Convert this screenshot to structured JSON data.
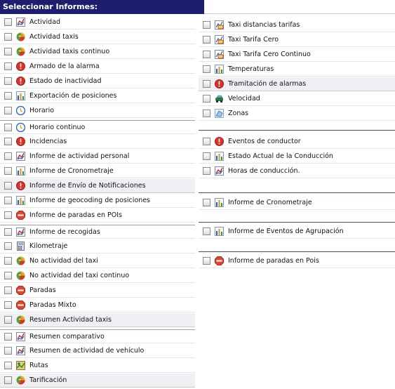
{
  "header": {
    "title": "Seleccionar Informes:"
  },
  "left": [
    {
      "label": "Actividad",
      "icon": "line-chart-icon"
    },
    {
      "label": "Actividad taxis",
      "icon": "taxi-pie-icon"
    },
    {
      "label": "Actividad taxis continuo",
      "icon": "taxi-pie-icon"
    },
    {
      "label": "Armado de la alarma",
      "icon": "alarm-icon"
    },
    {
      "label": "Estado de inactividad",
      "icon": "alarm-icon"
    },
    {
      "label": "Exportación de posiciones",
      "icon": "bar-chart-icon"
    },
    {
      "label": "Horario",
      "icon": "clock-icon"
    },
    {
      "label": "Horario continuo",
      "icon": "clock-icon"
    },
    {
      "label": "Incidencias",
      "icon": "alarm-icon"
    },
    {
      "label": "Informe de actividad personal",
      "icon": "line-chart-icon"
    },
    {
      "label": "Informe de Cronometraje",
      "icon": "bar-chart-icon"
    },
    {
      "label": "Informe de Envío de Notificaciones",
      "icon": "alarm-icon"
    },
    {
      "label": "Informe de geocoding de posiciones",
      "icon": "bar-chart-icon"
    },
    {
      "label": "Informe de paradas en POIs",
      "icon": "stop-icon"
    },
    {
      "label": "Informe de recogidas",
      "icon": "line-chart-icon"
    },
    {
      "label": "Kilometraje",
      "icon": "calculator-icon"
    },
    {
      "label": "No actividad del taxi",
      "icon": "taxi-pie-icon"
    },
    {
      "label": "No actividad del taxi continuo",
      "icon": "taxi-pie-icon"
    },
    {
      "label": "Paradas",
      "icon": "stop-icon"
    },
    {
      "label": "Paradas Mixto",
      "icon": "stop-icon"
    },
    {
      "label": "Resumen Actividad taxis",
      "icon": "taxi-pie-icon"
    },
    {
      "label": "Resumen comparativo",
      "icon": "line-chart-icon"
    },
    {
      "label": "Resumen de actividad de vehículo",
      "icon": "line-chart-icon"
    },
    {
      "label": "Rutas",
      "icon": "route-map-icon"
    },
    {
      "label": "Tarificación",
      "icon": "taxi-pie-icon"
    }
  ],
  "right": [
    {
      "label": "Taxi distancias tarifas",
      "icon": "taxi-chart-icon"
    },
    {
      "label": "Taxi Tarifa Cero",
      "icon": "taxi-chart-icon"
    },
    {
      "label": "Taxi Tarifa Cero Continuo",
      "icon": "taxi-chart-icon"
    },
    {
      "label": "Temperaturas",
      "icon": "bar-chart-icon"
    },
    {
      "label": "Tramitación de alarmas",
      "icon": "alarm-icon"
    },
    {
      "label": "Velocidad",
      "icon": "car-icon"
    },
    {
      "label": "Zonas",
      "icon": "zone-icon"
    },
    {
      "label": "Eventos de conductor",
      "icon": "alarm-icon"
    },
    {
      "label": "Estado Actual de la Conducción",
      "icon": "bar-chart-icon"
    },
    {
      "label": "Horas de conducción.",
      "icon": "line-chart-icon"
    },
    {
      "label": "Informe de Cronometraje",
      "icon": "bar-chart-icon"
    },
    {
      "label": "Informe de Eventos de Agrupación",
      "icon": "bar-chart-icon"
    },
    {
      "label": "Informe de paradas en Pois",
      "icon": "stop-icon"
    }
  ]
}
